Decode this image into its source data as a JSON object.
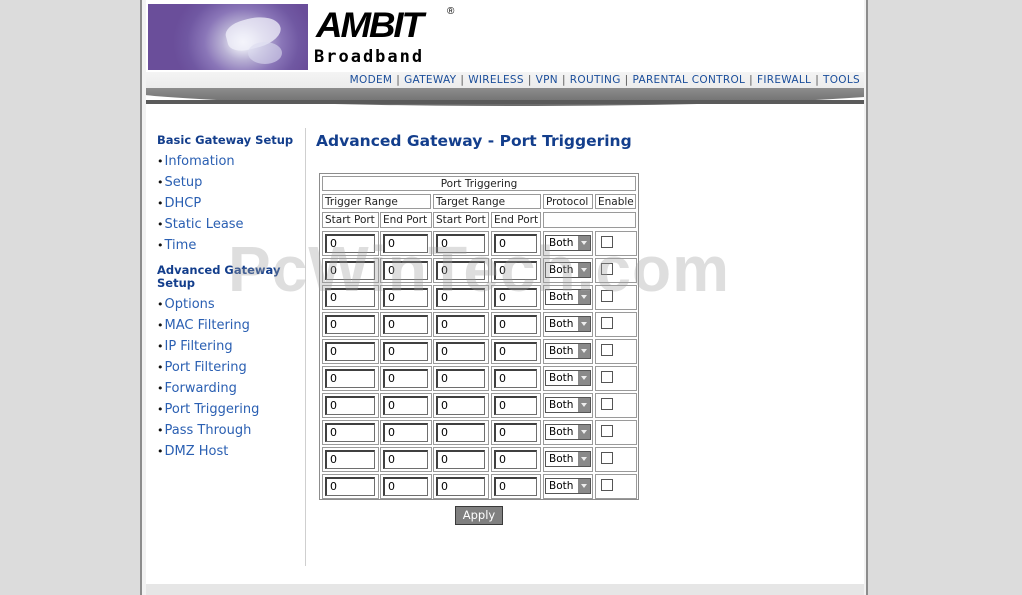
{
  "brand": {
    "name": "AMBIT",
    "registered": "®",
    "subtitle": "Broadband"
  },
  "nav": {
    "items": [
      "MODEM",
      "GATEWAY",
      "WIRELESS",
      "VPN",
      "ROUTING",
      "PARENTAL CONTROL",
      "FIREWALL",
      "TOOLS"
    ],
    "separator": "|"
  },
  "sidebar": {
    "bullet": "•",
    "basic_title": "Basic Gateway Setup",
    "basic_items": [
      "Infomation",
      "Setup",
      "DHCP",
      "Static Lease",
      "Time"
    ],
    "advanced_title_line1": "Advanced Gateway",
    "advanced_title_line2": "Setup",
    "advanced_items": [
      "Options",
      "MAC Filtering",
      "IP Filtering",
      "Port Filtering",
      "Forwarding",
      "Port Triggering",
      "Pass Through",
      "DMZ Host"
    ]
  },
  "main": {
    "title": "Advanced Gateway - Port Triggering",
    "watermark": "PcWinTech.com",
    "table": {
      "caption": "Port Triggering",
      "group_headers": [
        "Trigger Range",
        "Target Range",
        "Protocol",
        "Enable"
      ],
      "sub_headers": [
        "Start Port",
        "End Port",
        "Start Port",
        "End Port"
      ],
      "rows": [
        {
          "trigger_start": "0",
          "trigger_end": "0",
          "target_start": "0",
          "target_end": "0",
          "protocol": "Both",
          "enabled": false
        },
        {
          "trigger_start": "0",
          "trigger_end": "0",
          "target_start": "0",
          "target_end": "0",
          "protocol": "Both",
          "enabled": false
        },
        {
          "trigger_start": "0",
          "trigger_end": "0",
          "target_start": "0",
          "target_end": "0",
          "protocol": "Both",
          "enabled": false
        },
        {
          "trigger_start": "0",
          "trigger_end": "0",
          "target_start": "0",
          "target_end": "0",
          "protocol": "Both",
          "enabled": false
        },
        {
          "trigger_start": "0",
          "trigger_end": "0",
          "target_start": "0",
          "target_end": "0",
          "protocol": "Both",
          "enabled": false
        },
        {
          "trigger_start": "0",
          "trigger_end": "0",
          "target_start": "0",
          "target_end": "0",
          "protocol": "Both",
          "enabled": false
        },
        {
          "trigger_start": "0",
          "trigger_end": "0",
          "target_start": "0",
          "target_end": "0",
          "protocol": "Both",
          "enabled": false
        },
        {
          "trigger_start": "0",
          "trigger_end": "0",
          "target_start": "0",
          "target_end": "0",
          "protocol": "Both",
          "enabled": false
        },
        {
          "trigger_start": "0",
          "trigger_end": "0",
          "target_start": "0",
          "target_end": "0",
          "protocol": "Both",
          "enabled": false
        },
        {
          "trigger_start": "0",
          "trigger_end": "0",
          "target_start": "0",
          "target_end": "0",
          "protocol": "Both",
          "enabled": false
        }
      ]
    },
    "apply_label": "Apply"
  },
  "colors": {
    "title_blue": "#133e8c",
    "link_blue": "#2a5fb2",
    "nav_blue": "#1a4d9a",
    "button_gray": "#808080"
  }
}
